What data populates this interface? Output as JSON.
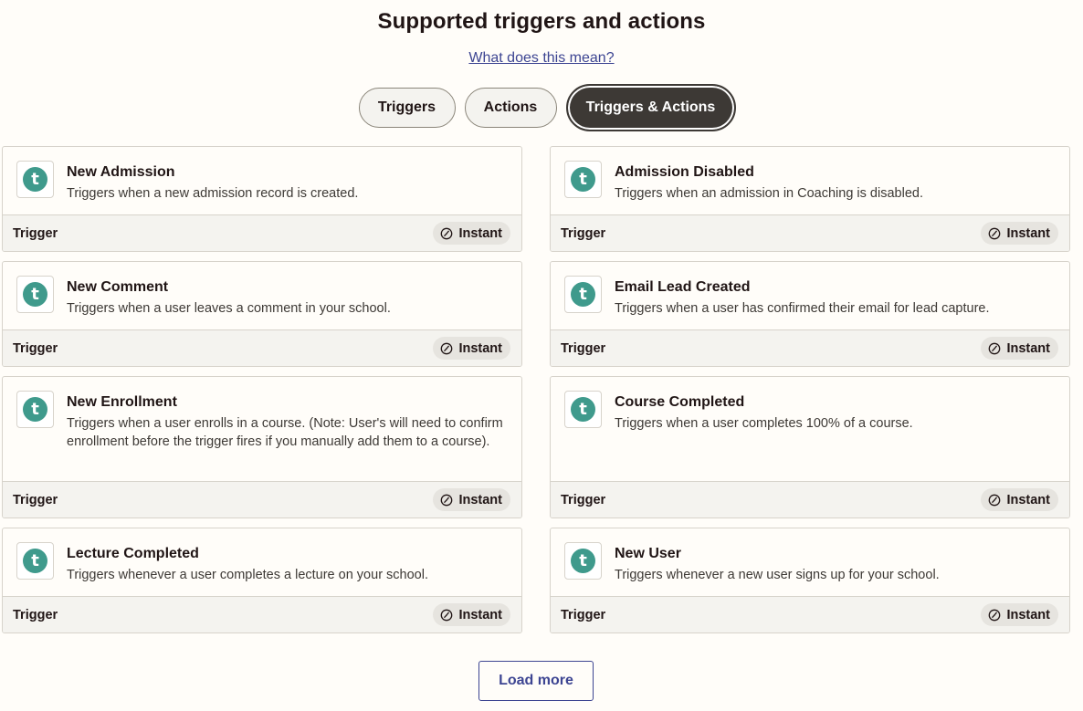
{
  "header": {
    "title": "Supported triggers and actions",
    "help_link": "What does this mean?"
  },
  "tabs": [
    {
      "label": "Triggers",
      "selected": false
    },
    {
      "label": "Actions",
      "selected": false
    },
    {
      "label": "Triggers & Actions",
      "selected": true
    }
  ],
  "colors": {
    "app_icon": "#3f9a8c",
    "selected_tab": "#3d3935",
    "link": "#3d4592"
  },
  "app_icon_letter": "t",
  "cards": [
    {
      "name": "New Admission",
      "description": "Triggers when a new admission record is created.",
      "type": "Trigger",
      "badge": "Instant",
      "icon": "clock-icon"
    },
    {
      "name": "Admission Disabled",
      "description": "Triggers when an admission in Coaching is disabled.",
      "type": "Trigger",
      "badge": "Instant",
      "icon": "clock-icon"
    },
    {
      "name": "New Comment",
      "description": "Triggers when a user leaves a comment in your school.",
      "type": "Trigger",
      "badge": "Instant",
      "icon": "clock-icon"
    },
    {
      "name": "Email Lead Created",
      "description": "Triggers when a user has confirmed their email for lead capture.",
      "type": "Trigger",
      "badge": "Instant",
      "icon": "clock-icon"
    },
    {
      "name": "New Enrollment",
      "description": "Triggers when a user enrolls in a course. (Note: User's will need to confirm enrollment before the trigger fires if you manually add them to a course).",
      "type": "Trigger",
      "badge": "Instant",
      "icon": "clock-icon"
    },
    {
      "name": "Course Completed",
      "description": "Triggers when a user completes 100% of a course.",
      "type": "Trigger",
      "badge": "Instant",
      "icon": "clock-icon"
    },
    {
      "name": "Lecture Completed",
      "description": "Triggers whenever a user completes a lecture on your school.",
      "type": "Trigger",
      "badge": "Instant",
      "icon": "clock-icon"
    },
    {
      "name": "New User",
      "description": "Triggers whenever a new user signs up for your school.",
      "type": "Trigger",
      "badge": "Instant",
      "icon": "clock-icon"
    }
  ],
  "load_more_label": "Load more"
}
